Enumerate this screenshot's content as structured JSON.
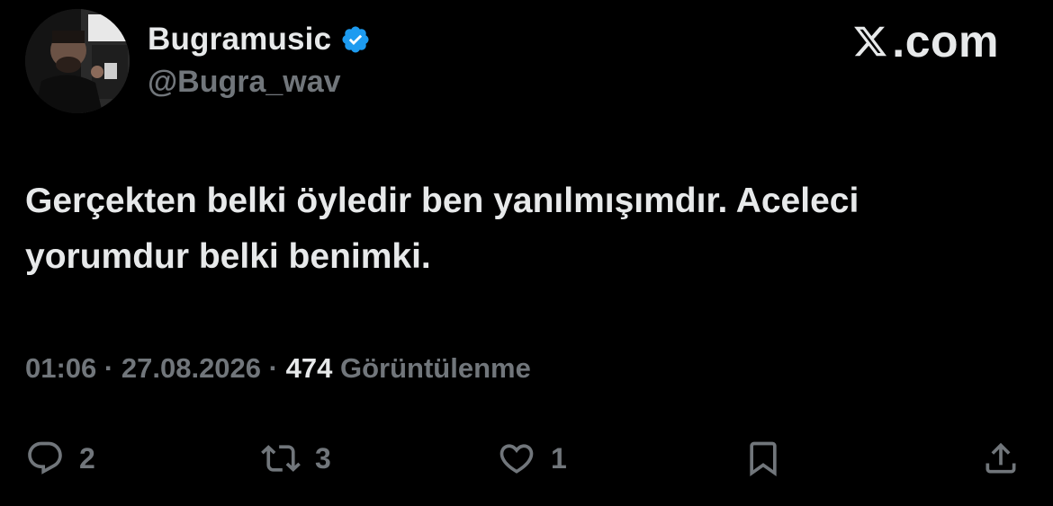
{
  "author": {
    "display_name": "Bugramusic",
    "handle": "@Bugra_wav",
    "verified": true
  },
  "brand": {
    "text": "com",
    "dot": "."
  },
  "tweet": {
    "lines": [
      "Gerçekten belki öyledir ben yanılmışımdır. Aceleci",
      "yorumdur belki benimki."
    ]
  },
  "meta": {
    "time": "01:06",
    "separator": "·",
    "date": "27.08.2026",
    "views_count": "474",
    "views_label": "Görüntülenme"
  },
  "actions": {
    "replies": "2",
    "reposts": "3",
    "likes": "1"
  },
  "colors": {
    "background": "#000000",
    "primary_text": "#e7e9ea",
    "secondary_text": "#71767b",
    "verified_badge": "#1d9bf0"
  },
  "icons": {
    "verified": "verified-badge-icon",
    "reply": "reply-icon",
    "repost": "repost-icon",
    "like": "heart-icon",
    "bookmark": "bookmark-icon",
    "share": "share-icon",
    "brand": "x-logo-icon"
  }
}
